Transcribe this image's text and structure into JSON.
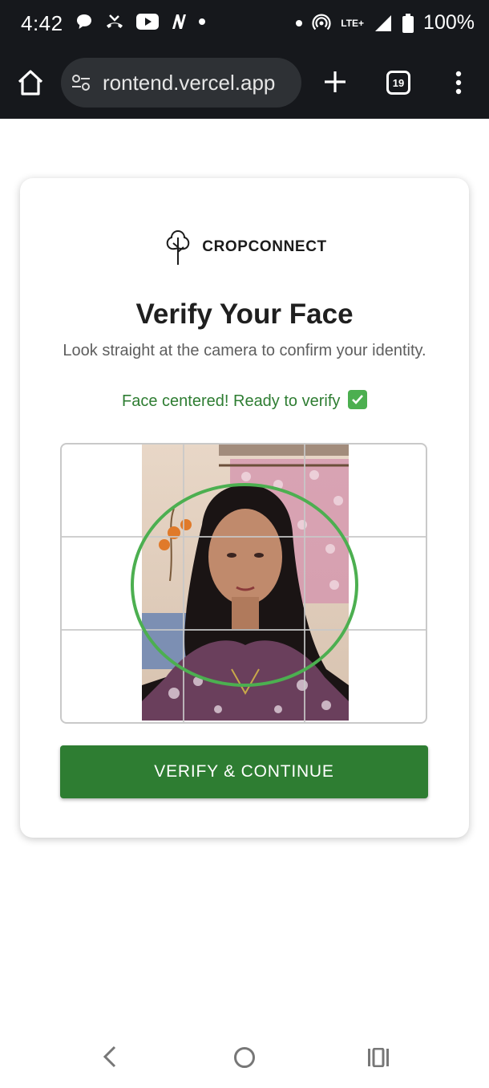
{
  "status_bar": {
    "time": "4:42",
    "network": "LTE+",
    "battery": "100%"
  },
  "browser": {
    "url": "rontend.vercel.app",
    "tab_count": "19"
  },
  "card": {
    "brand_name": "CROPCONNECT",
    "title": "Verify Your Face",
    "subtitle": "Look straight at the camera to confirm your identity.",
    "status_message": "Face centered! Ready to verify",
    "verify_button": "VERIFY & CONTINUE"
  },
  "colors": {
    "accent_green": "#2e7d32",
    "ring_green": "#4caf50",
    "chrome_dark": "#16181c"
  }
}
